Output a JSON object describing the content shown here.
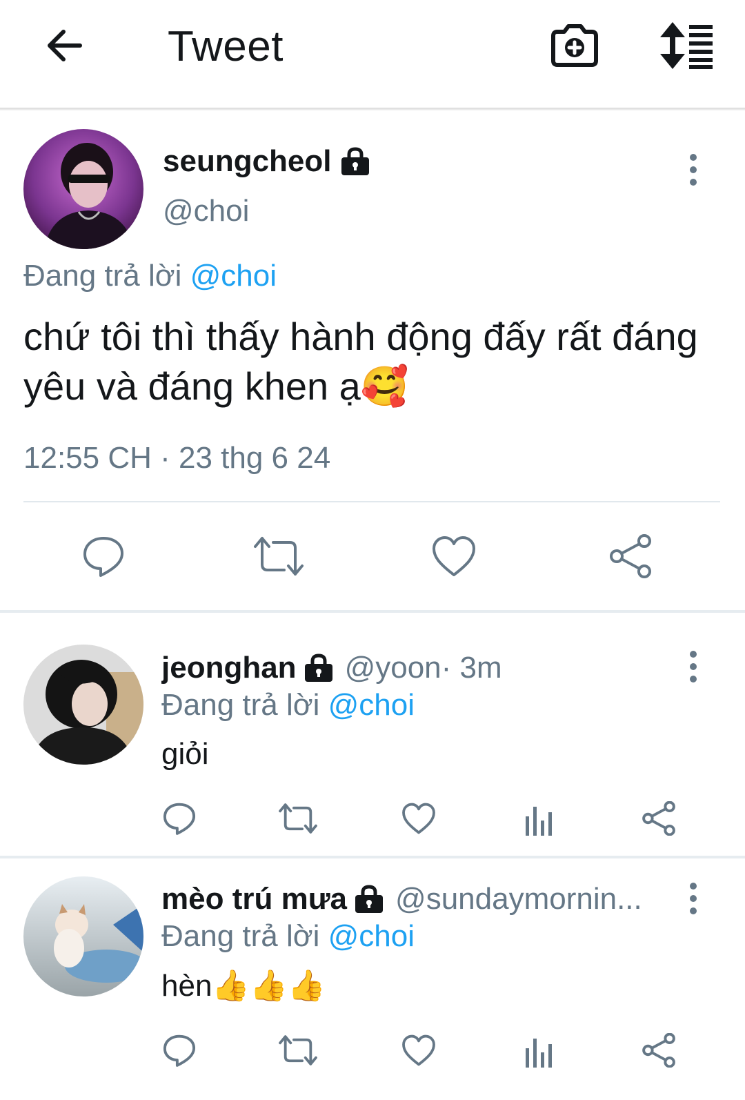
{
  "header": {
    "title": "Tweet",
    "icons": {
      "back": "arrow-left-icon",
      "camera": "camera-add-icon",
      "sort": "sort-icon"
    }
  },
  "main_tweet": {
    "display_name": "seungcheol",
    "handle": "@choi",
    "replying_prefix": "Đang trả lời",
    "replying_to": "@choi",
    "text": "chứ tôi thì thấy hành động đấy rất đáng yêu và đáng khen ạ",
    "emoji": "🥰",
    "timestamp": "12:55 CH · 23 thg 6 24",
    "locked": true
  },
  "replies": [
    {
      "display_name": "jeonghan",
      "handle": "@yoon",
      "time": " · 3m",
      "replying_prefix": "Đang trả lời",
      "replying_to": "@choi",
      "text": "giỏi",
      "emoji": "",
      "locked": true
    },
    {
      "display_name": "mèo trú mưa",
      "handle": "@sundaymornin...",
      "time": "",
      "replying_prefix": "Đang trả lời",
      "replying_to": "@choi",
      "text": "hèn",
      "emoji": "👍👍👍",
      "locked": true
    }
  ],
  "colors": {
    "text": "#14171a",
    "secondary": "#657786",
    "accent": "#1da1f2",
    "icon": "#657786",
    "divider": "#e1e8ed"
  }
}
